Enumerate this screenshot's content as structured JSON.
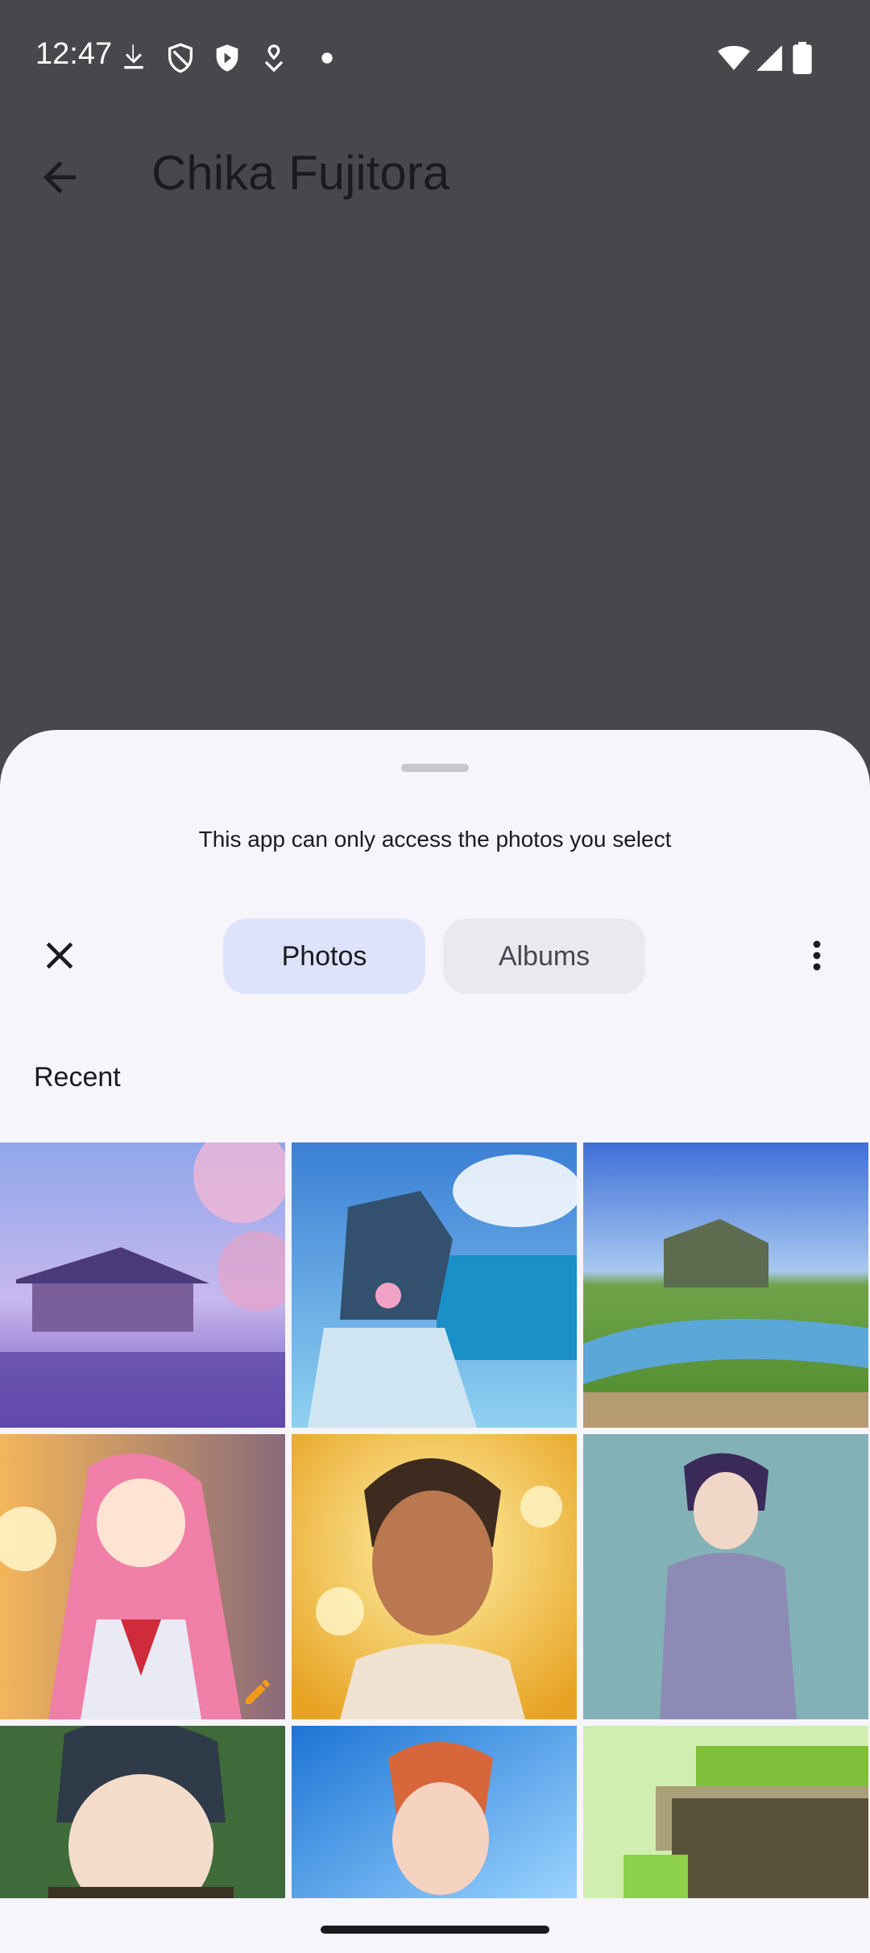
{
  "status_bar": {
    "time": "12:47",
    "icons": [
      "download-icon",
      "shield-outline-icon",
      "shield-filled-icon",
      "location-pin-icon",
      "dot-icon"
    ],
    "right_icons": [
      "wifi-icon",
      "signal-icon",
      "battery-icon"
    ]
  },
  "app_bar": {
    "title": "Chika Fujitora"
  },
  "sheet": {
    "notice": "This app can only access the photos you select",
    "tabs": [
      {
        "label": "Photos",
        "selected": true
      },
      {
        "label": "Albums",
        "selected": false
      }
    ],
    "section_title": "Recent"
  },
  "colors": {
    "scrim": "#48474b",
    "sheet_bg": "#f6f5fb",
    "tab_selected": "#dce3fb",
    "tab_unselected": "#eaeaee"
  }
}
